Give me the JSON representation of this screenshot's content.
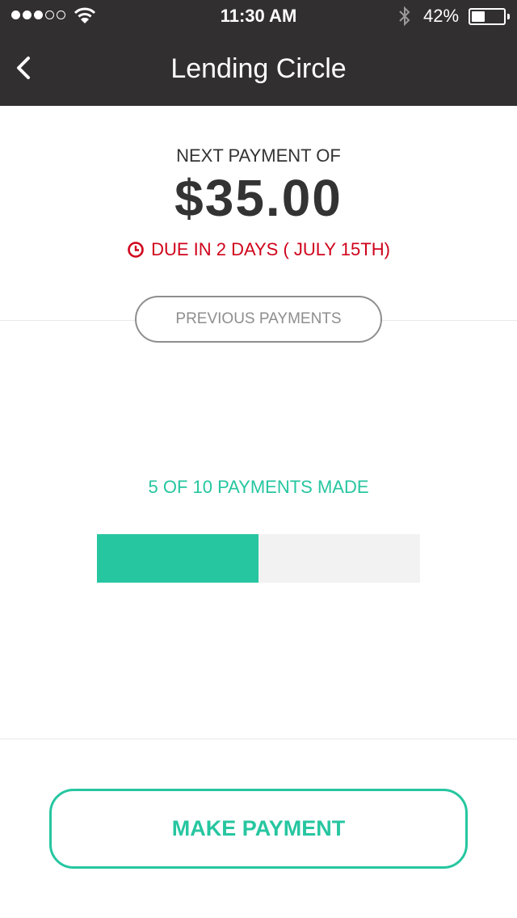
{
  "status_bar": {
    "time": "11:30 AM",
    "battery_percent_label": "42%",
    "battery_level": 0.42,
    "signal_bars_filled": 3,
    "signal_bars_total": 5
  },
  "nav": {
    "title": "Lending Circle",
    "back_icon": "chevron-left-icon"
  },
  "payment": {
    "next_label": "NEXT PAYMENT OF",
    "amount": "$35.00",
    "due_text": "DUE IN 2 DAYS ( JULY 15TH)",
    "due_icon": "clock-icon"
  },
  "previous_payments_label": "PREVIOUS PAYMENTS",
  "progress": {
    "label": "5 OF 10 PAYMENTS MADE",
    "made": 5,
    "total": 10
  },
  "make_payment_label": "MAKE PAYMENT",
  "colors": {
    "header_bg": "#322f30",
    "accent": "#26c6a0",
    "due_red": "#d0021b",
    "muted_gray": "#8e8e8e",
    "track_gray": "#f2f2f2"
  }
}
